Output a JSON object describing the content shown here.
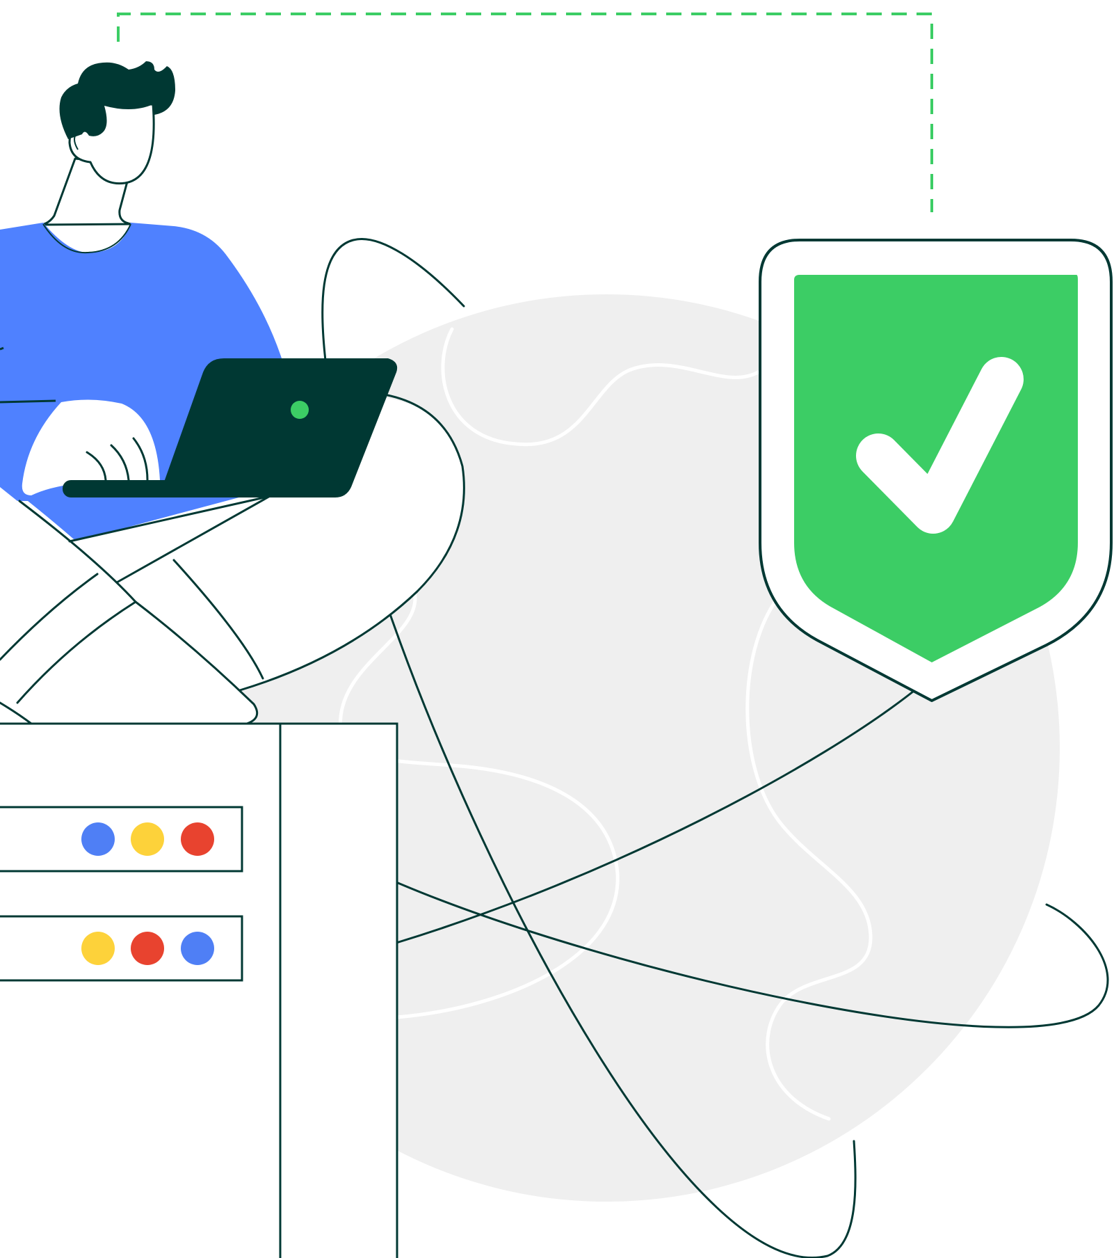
{
  "illustration": {
    "colors": {
      "background": "#ffffff",
      "globe": "#efefef",
      "outline": "#003833",
      "brand_green": "#3ccd65",
      "shirt_blue": "#4f81ff",
      "hair_dark": "#003833",
      "dot_blue": "#4f7ff5",
      "dot_yellow": "#fdd23a",
      "dot_red": "#e8432f"
    },
    "icons": {
      "shield": "shield-check-icon",
      "check": "check-icon",
      "connector": "dashed-connector",
      "server": "server-rack-icon",
      "laptop": "laptop-icon",
      "person": "person-working-icon"
    },
    "server_slots": [
      {
        "name": "server-slot-1",
        "dots": [
          "dot_blue",
          "dot_yellow",
          "dot_red"
        ]
      },
      {
        "name": "server-slot-2",
        "dots": [
          "dot_yellow",
          "dot_red",
          "dot_blue"
        ]
      }
    ]
  }
}
